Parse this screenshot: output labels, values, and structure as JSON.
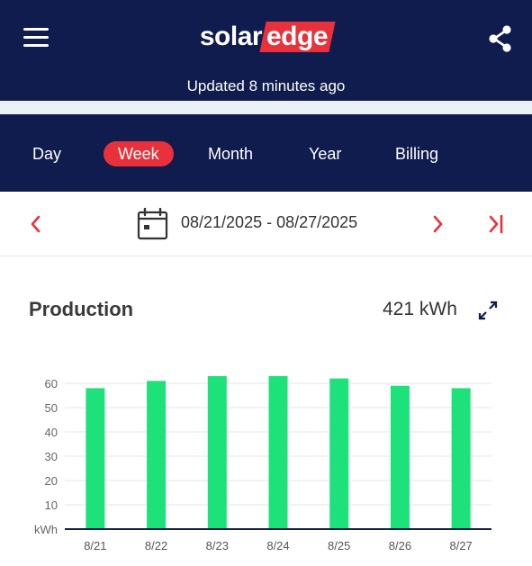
{
  "header": {
    "logo_part1": "solar",
    "logo_part2": "edge",
    "updated_text": "Updated 8 minutes ago"
  },
  "icons": {
    "menu": "hamburger-icon",
    "share": "share-icon",
    "previous": "chevron-left-icon",
    "next": "chevron-right-icon",
    "latest": "skip-to-end-icon",
    "calendar": "calendar-icon",
    "expand": "expand-icon"
  },
  "tabs": [
    {
      "label": "Day",
      "active": false
    },
    {
      "label": "Week",
      "active": true
    },
    {
      "label": "Month",
      "active": false
    },
    {
      "label": "Year",
      "active": false
    },
    {
      "label": "Billing",
      "active": false
    }
  ],
  "date_range": "08/21/2025 - 08/27/2025",
  "production": {
    "title": "Production",
    "total": "421 kWh"
  },
  "colors": {
    "navy": "#0f1c4d",
    "accent_red": "#e8313a",
    "bar_green": "#1de27a",
    "baseline": "#14204a"
  },
  "chart_data": {
    "type": "bar",
    "categories": [
      "8/21",
      "8/22",
      "8/23",
      "8/24",
      "8/25",
      "8/26",
      "8/27"
    ],
    "values": [
      58,
      61,
      63,
      63,
      62,
      59,
      58
    ],
    "y_ticks": [
      "kWh",
      "10",
      "20",
      "30",
      "40",
      "50",
      "60"
    ],
    "ylabel": "kWh",
    "ylim": [
      0,
      60
    ],
    "grid": true,
    "legend": "none"
  }
}
